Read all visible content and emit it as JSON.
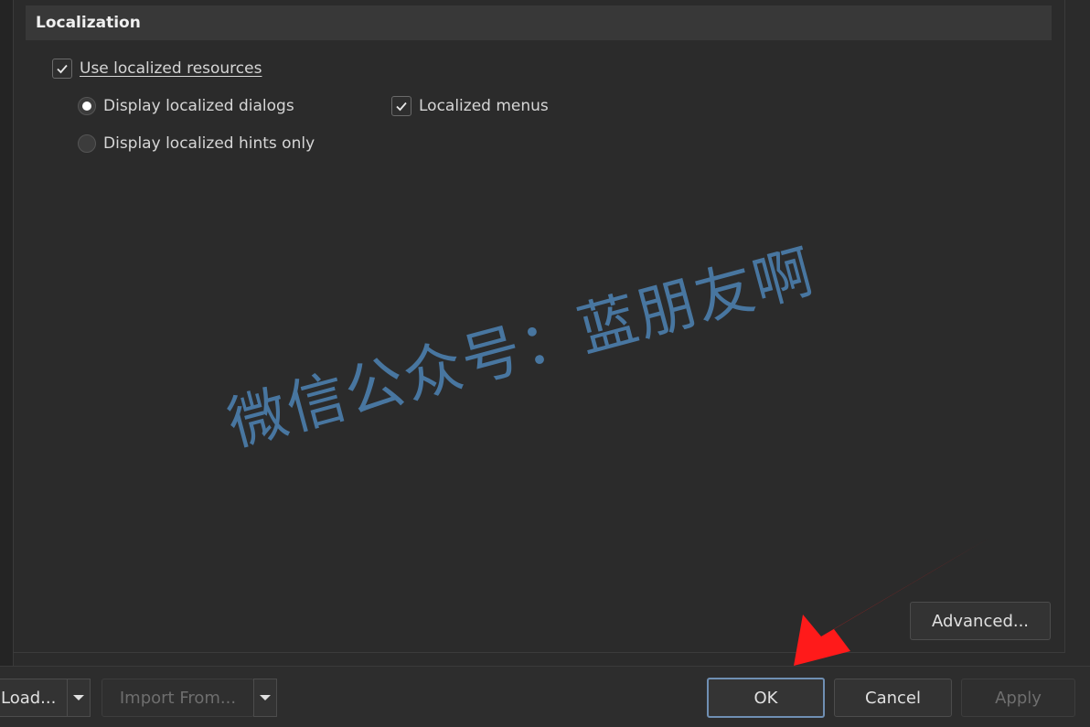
{
  "section": {
    "title": "Localization"
  },
  "options": {
    "use_localized_resources": {
      "label": "Use localized resources",
      "checked": true
    },
    "display_localized_dialogs": {
      "label": "Display localized dialogs",
      "selected": true
    },
    "display_localized_hints_only": {
      "label": "Display localized hints only",
      "selected": false
    },
    "localized_menus": {
      "label": "Localized menus",
      "checked": true
    }
  },
  "buttons": {
    "advanced": "Advanced...",
    "load": "Load...",
    "import_from": "Import From...",
    "ok": "OK",
    "cancel": "Cancel",
    "apply": "Apply"
  },
  "watermark": "微信公众号：蓝朋友啊",
  "colors": {
    "accent_border": "#6f8fb3",
    "watermark": "#4e84b5",
    "annotation_arrow": "#ff1a1a"
  }
}
